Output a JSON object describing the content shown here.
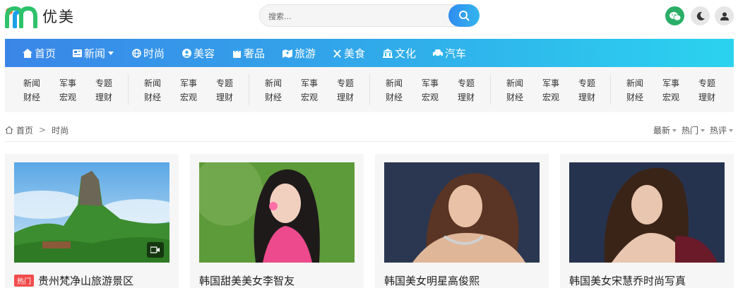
{
  "site": {
    "name": "优美"
  },
  "search": {
    "placeholder": "搜索..."
  },
  "nav": {
    "items": [
      {
        "label": "首页",
        "icon": "home-icon"
      },
      {
        "label": "新闻",
        "icon": "news-icon",
        "dropdown": true
      },
      {
        "label": "时尚",
        "icon": "globe-icon"
      },
      {
        "label": "美容",
        "icon": "user-circle-icon"
      },
      {
        "label": "奢品",
        "icon": "bag-icon"
      },
      {
        "label": "旅游",
        "icon": "map-icon"
      },
      {
        "label": "美食",
        "icon": "utensils-icon"
      },
      {
        "label": "文化",
        "icon": "building-icon"
      },
      {
        "label": "汽车",
        "icon": "car-icon"
      }
    ]
  },
  "subnav": {
    "groups": [
      [
        "新闻",
        "军事",
        "专题",
        "财经",
        "宏观",
        "理财"
      ],
      [
        "新闻",
        "军事",
        "专题",
        "财经",
        "宏观",
        "理财"
      ],
      [
        "新闻",
        "军事",
        "专题",
        "财经",
        "宏观",
        "理财"
      ],
      [
        "新闻",
        "军事",
        "专题",
        "财经",
        "宏观",
        "理财"
      ],
      [
        "新闻",
        "军事",
        "专题",
        "财经",
        "宏观",
        "理财"
      ],
      [
        "新闻",
        "军事",
        "专题",
        "财经",
        "宏观",
        "理财"
      ]
    ]
  },
  "breadcrumb": {
    "home": "首页",
    "current": "时尚"
  },
  "sort": {
    "latest": "最新",
    "hot": "热门",
    "comments": "热评"
  },
  "cards": [
    {
      "tag": "热门",
      "title": "贵州梵净山旅游景区",
      "has_video": true
    },
    {
      "title": "韩国甜美美女李智友"
    },
    {
      "title": "韩国美女明星高俊熙"
    },
    {
      "title": "韩国美女宋慧乔时尚写真"
    }
  ],
  "colors": {
    "accent": "#2f8cf0",
    "hot": "#f24b4b",
    "wechat": "#2aae67"
  }
}
